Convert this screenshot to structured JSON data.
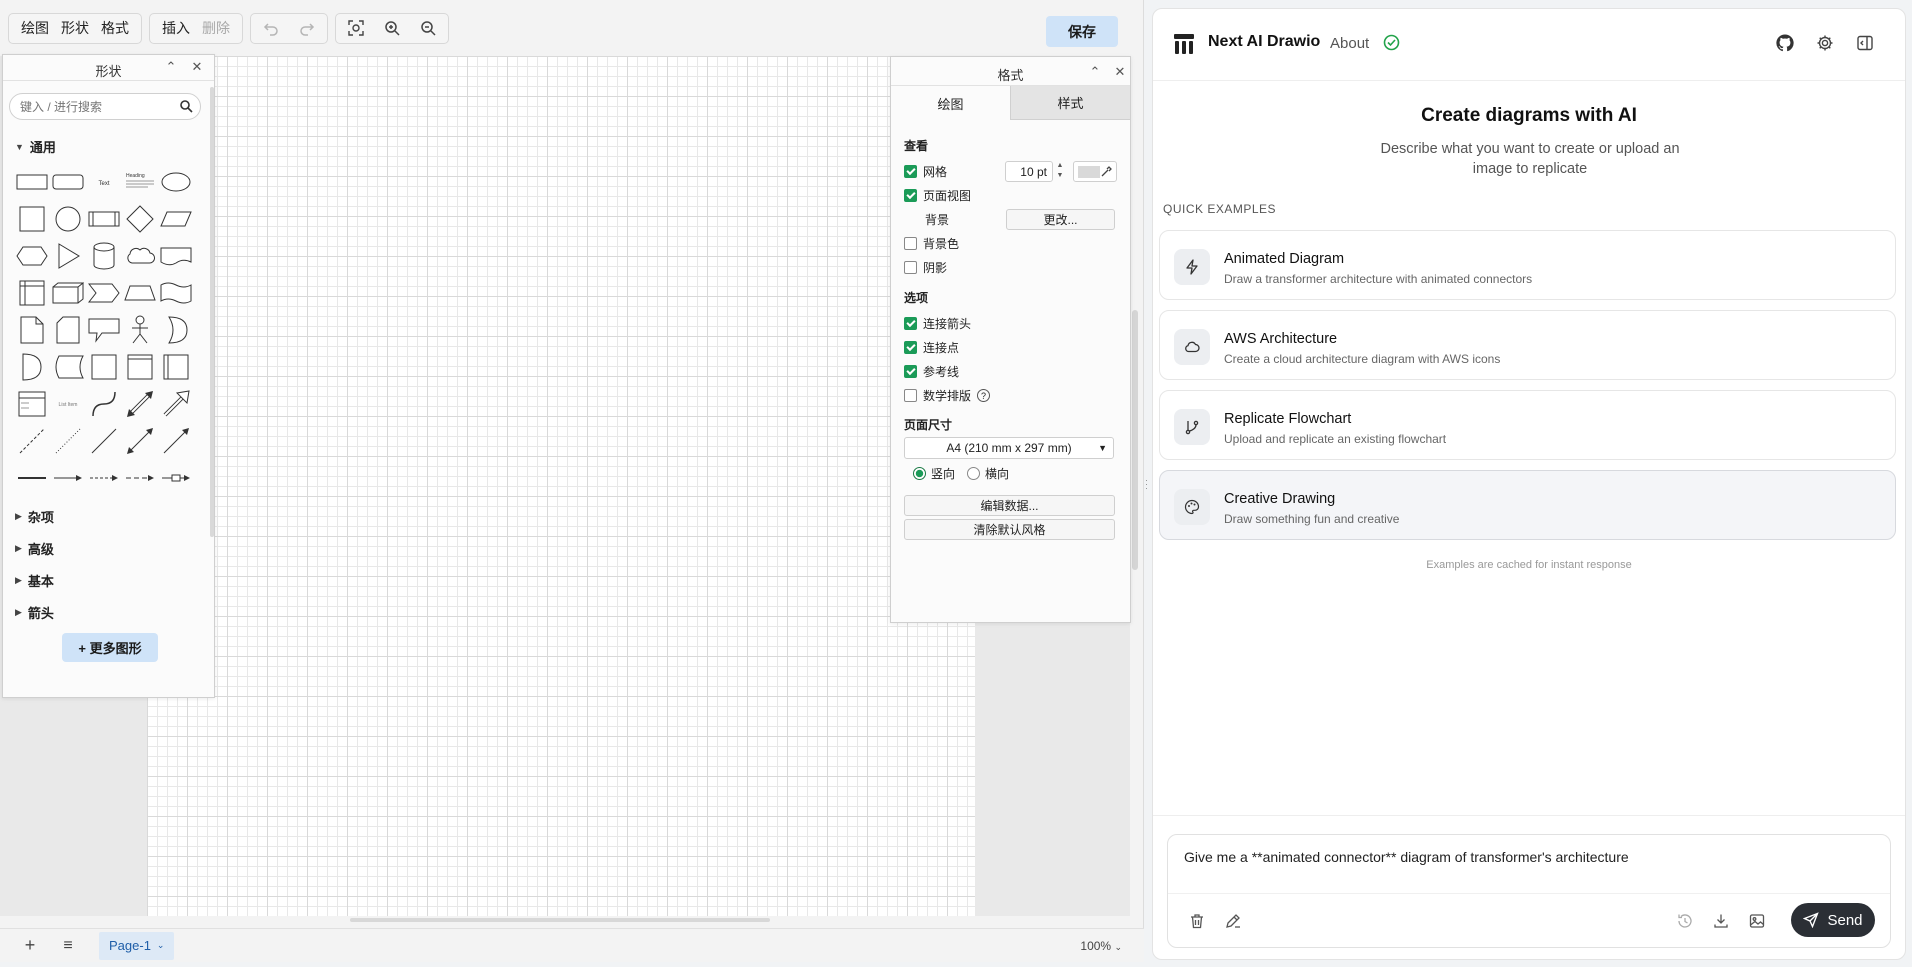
{
  "toolbar": {
    "menu1": [
      "绘图",
      "形状",
      "格式"
    ],
    "menu2": [
      "插入",
      "删除"
    ],
    "save_label": "保存"
  },
  "shapes_panel": {
    "title": "形状",
    "search_placeholder": "键入 / 进行搜索",
    "section_general": "通用",
    "sections": [
      "杂项",
      "高级",
      "基本",
      "箭头"
    ],
    "more_shapes": "+ 更多图形"
  },
  "format_panel": {
    "title": "格式",
    "tabs": [
      "绘图",
      "样式"
    ],
    "view_heading": "查看",
    "grid_label": "网格",
    "grid_size": "10 pt",
    "page_view_label": "页面视图",
    "background_label": "背景",
    "change_button": "更改...",
    "bg_color_label": "背景色",
    "shadow_label": "阴影",
    "options_heading": "选项",
    "connection_arrows": "连接箭头",
    "connection_points": "连接点",
    "guides": "参考线",
    "math": "数学排版",
    "page_size_heading": "页面尺寸",
    "page_size_value": "A4 (210 mm x 297 mm)",
    "portrait": "竖向",
    "landscape": "横向",
    "edit_data": "编辑数据...",
    "clear_style": "清除默认风格",
    "checks": {
      "grid": true,
      "page_view": true,
      "bg_color": false,
      "shadow": false,
      "connection_arrows": true,
      "connection_points": true,
      "guides": true,
      "math": false
    }
  },
  "bottom_bar": {
    "page_tab": "Page-1",
    "zoom": "100%"
  },
  "ai_panel": {
    "app_title": "Next AI Drawio",
    "about": "About",
    "hero_title": "Create diagrams with AI",
    "hero_subtitle": "Describe what you want to create or upload an image to replicate",
    "quick_examples_label": "QUICK EXAMPLES",
    "examples": [
      {
        "title": "Animated Diagram",
        "desc": "Draw a transformer architecture with animated connectors",
        "icon": "zap-icon"
      },
      {
        "title": "AWS Architecture",
        "desc": "Create a cloud architecture diagram with AWS icons",
        "icon": "cloud-icon"
      },
      {
        "title": "Replicate Flowchart",
        "desc": "Upload and replicate an existing flowchart",
        "icon": "git-branch-icon"
      },
      {
        "title": "Creative Drawing",
        "desc": "Draw something fun and creative",
        "icon": "palette-icon"
      }
    ],
    "cache_note": "Examples are cached for instant response",
    "prompt": "Give me a **animated connector** diagram of transformer's architecture",
    "send_label": "Send",
    "accent": "#22a34a"
  }
}
